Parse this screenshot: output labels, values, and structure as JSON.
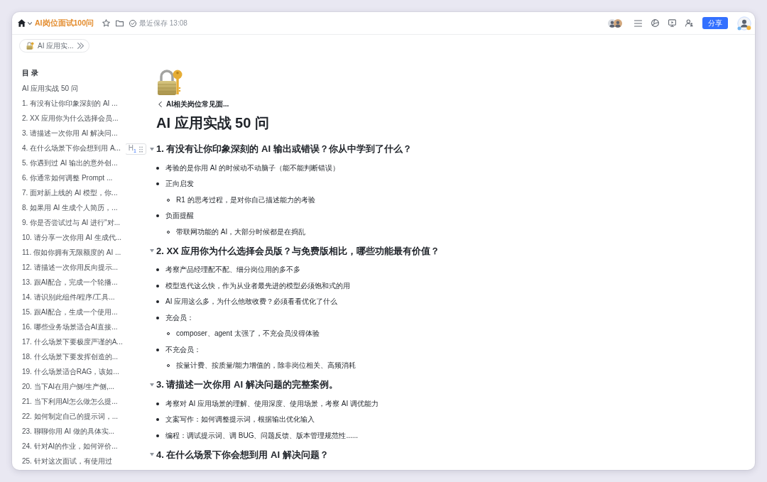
{
  "top_bar": {
    "title": "AI岗位面试100问",
    "save_status": "最近保存 13:08",
    "share_button": "分享"
  },
  "breadcrumb": {
    "label": "AI 应用实..."
  },
  "outline": {
    "heading": "目 录",
    "items": [
      {
        "label": "AI 应用实战 50 问",
        "selected": false
      },
      {
        "label": "1. 有没有让你印象深刻的 AI ...",
        "selected": false
      },
      {
        "label": "2. XX 应用你为什么选择会员...",
        "selected": false
      },
      {
        "label": "3. 请描述一次你用 AI 解决问...",
        "selected": false
      },
      {
        "label": "4. 在什么场景下你会想到用 A...",
        "selected": false
      },
      {
        "label": "5. 你遇到过 AI 输出的意外创...",
        "selected": false
      },
      {
        "label": "6. 你通常如何调整 Prompt ...",
        "selected": false
      },
      {
        "label": "7. 面对新上线的 AI 模型，你...",
        "selected": false
      },
      {
        "label": "8. 如果用 AI 生成个人简历，...",
        "selected": false
      },
      {
        "label": "9. 你是否尝试过与 AI 进行\"对...",
        "selected": false
      },
      {
        "label": "10. 请分享一次你用 AI 生成代...",
        "selected": false
      },
      {
        "label": "11. 假如你拥有无限额度的 AI ...",
        "selected": false
      },
      {
        "label": "12. 请描述一次你用反向提示...",
        "selected": false
      },
      {
        "label": "13. 跟AI配合，完成一个轮播...",
        "selected": false
      },
      {
        "label": "14. 请识别此组件/程序/工具...",
        "selected": false
      },
      {
        "label": "15. 跟AI配合，生成一个使用...",
        "selected": false
      },
      {
        "label": "16. 哪些业务场景适合AI直接...",
        "selected": false
      },
      {
        "label": "17. 什么场景下要极度严谨的A...",
        "selected": false
      },
      {
        "label": "18. 什么场景下要发挥创造的...",
        "selected": false
      },
      {
        "label": "19. 什么场景适合RAG，该如...",
        "selected": false
      },
      {
        "label": "20. 当下AI在用户侧/生产侧,...",
        "selected": false
      },
      {
        "label": "21. 当下利用AI怎么做怎么提...",
        "selected": false
      },
      {
        "label": "22. 如何制定自己的提示词，...",
        "selected": false
      },
      {
        "label": "23. 聊聊你用 AI 做的具体实...",
        "selected": false
      },
      {
        "label": "24. 针对AI的作业，如何评价...",
        "selected": false
      },
      {
        "label": "25. 针对这次面试，有使用过",
        "selected": false
      }
    ]
  },
  "document": {
    "parent_link": "AI相关岗位常见面...",
    "title": "AI 应用实战 50 问",
    "sections": [
      {
        "heading": "1. 有没有让你印象深刻的 AI 输出或错误？你从中学到了什么？",
        "expanded": true,
        "handle": "H$_{1}$",
        "items": [
          {
            "text": "考验的是你用 AI 的时候动不动脑子（能不能判断错误）"
          },
          {
            "text": "正向启发",
            "children": [
              {
                "text": "R1 的思考过程，是对你自己描述能力的考验"
              }
            ]
          },
          {
            "text": "负面提醒",
            "children": [
              {
                "text": "带联网功能的 AI，大部分时候都是在捣乱"
              }
            ]
          }
        ]
      },
      {
        "heading": "2. XX 应用你为什么选择会员版？与免费版相比，哪些功能最有价值？",
        "expanded": true,
        "items": [
          {
            "text": "考察产品经理配不配、细分岗位用的多不多"
          },
          {
            "text": "模型迭代这么快，作为从业者最先进的模型必须饱和式的用"
          },
          {
            "text": "AI 应用这么多，为什么他敢收费？必须看看优化了什么"
          },
          {
            "text": "充会员：",
            "children": [
              {
                "text": "composer、agent 太强了，不充会员没得体验"
              }
            ]
          },
          {
            "text": "不充会员：",
            "children": [
              {
                "text": "按量计费、按质量/能力增值的，除非岗位相关、高频消耗"
              }
            ]
          }
        ]
      },
      {
        "heading": "3. 请描述一次你用 AI 解决问题的完整案例。",
        "expanded": true,
        "items": [
          {
            "text": "考察对 AI 应用场景的理解、使用深度、使用场景，考察 AI 调优能力"
          },
          {
            "text": "文案写作：如何调整提示词，根据输出优化输入"
          },
          {
            "text": "编程：调试提示词、调 BUG、问题反馈、版本管理规范性......"
          }
        ]
      },
      {
        "heading": "4. 在什么场景下你会想到用 AI 解决问题？",
        "expanded": true
      }
    ]
  }
}
